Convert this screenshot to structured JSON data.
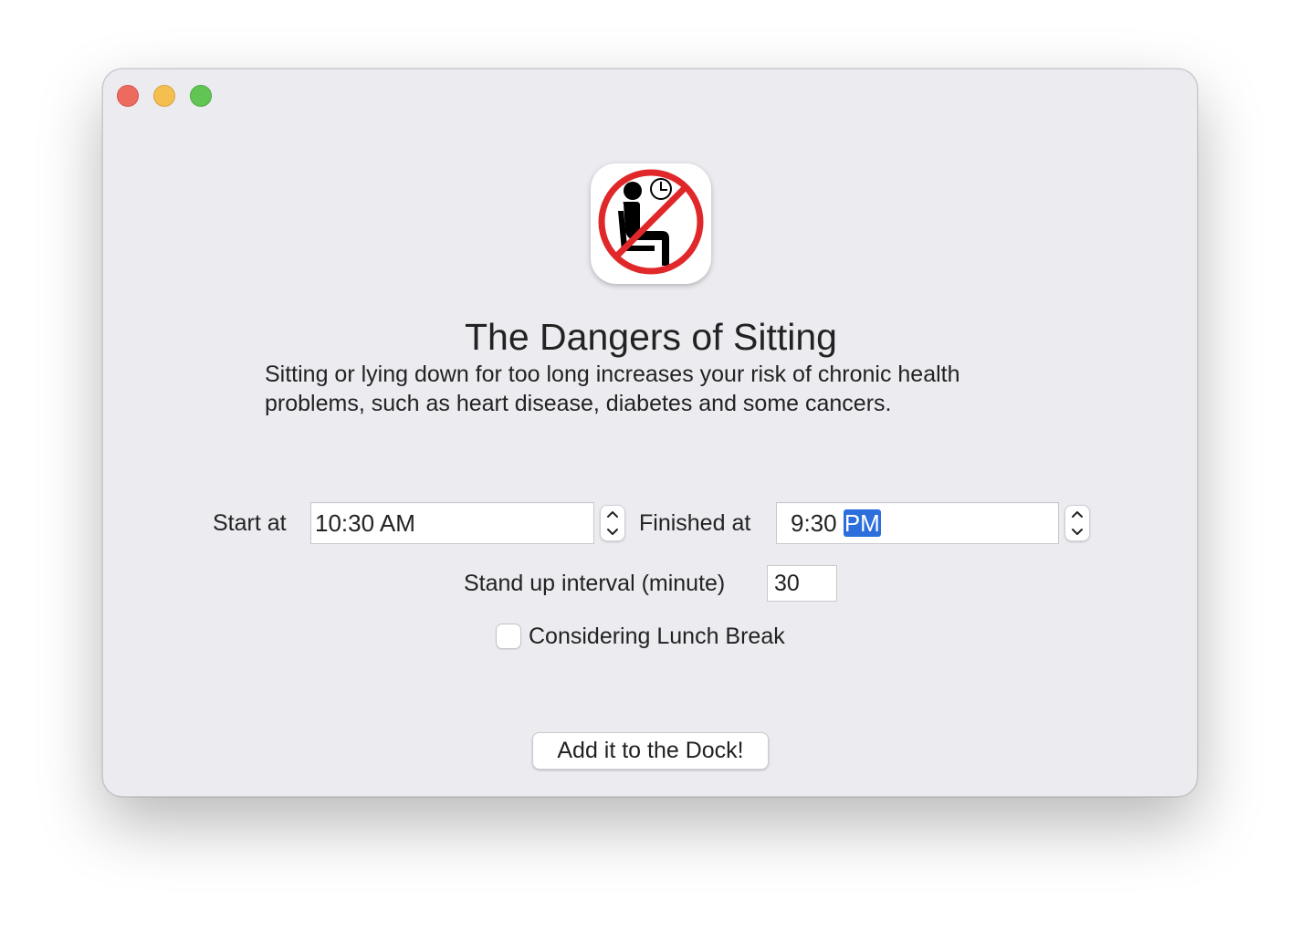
{
  "window": {
    "controls": {
      "close_color": "#ed6a5e",
      "minimize_color": "#f5bf4f",
      "zoom_color": "#61c554"
    }
  },
  "app_icon": {
    "name": "no-sitting-icon",
    "accent_color": "#e0282a"
  },
  "title": "The Dangers of Sitting",
  "description": {
    "line1": "Sitting or lying down for too long increases your risk of chronic health",
    "line2": "problems, such as heart disease, diabetes and some cancers."
  },
  "form": {
    "start_label": "Start at",
    "start_value": "10:30 AM",
    "finish_label": "Finished at",
    "finish_time": "9:30",
    "finish_ampm": "PM",
    "interval_label": "Stand up interval (minute)",
    "interval_value": "30",
    "lunch_label": "Considering Lunch Break",
    "lunch_checked": false
  },
  "button": {
    "label": "Add it to the Dock!"
  },
  "colors": {
    "selection": "#2c6fdc",
    "window_bg": "#ecebf0"
  }
}
